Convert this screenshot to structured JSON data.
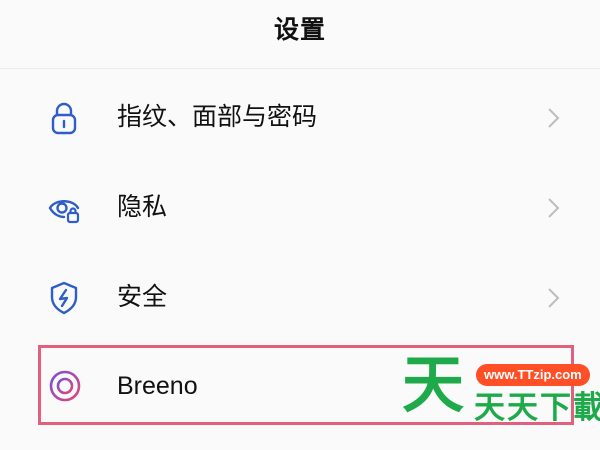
{
  "header": {
    "title": "设置"
  },
  "settings": {
    "items": [
      {
        "label": "指纹、面部与密码",
        "icon": "lock-icon"
      },
      {
        "label": "隐私",
        "icon": "privacy-eye-lock-icon"
      },
      {
        "label": "安全",
        "icon": "security-shield-icon"
      },
      {
        "label": "Breeno",
        "icon": "breeno-ring-icon"
      }
    ]
  },
  "colors": {
    "icon_blue": "#2f5ec8",
    "highlight_border": "#e0607e",
    "watermark_green": "#1eaa4a",
    "watermark_pill": "#ff4f26",
    "chevron": "#bdbdbd"
  },
  "watermark": {
    "big_char": "天",
    "pill_text": "www.TTzip.com",
    "small_text": "天天下載"
  }
}
